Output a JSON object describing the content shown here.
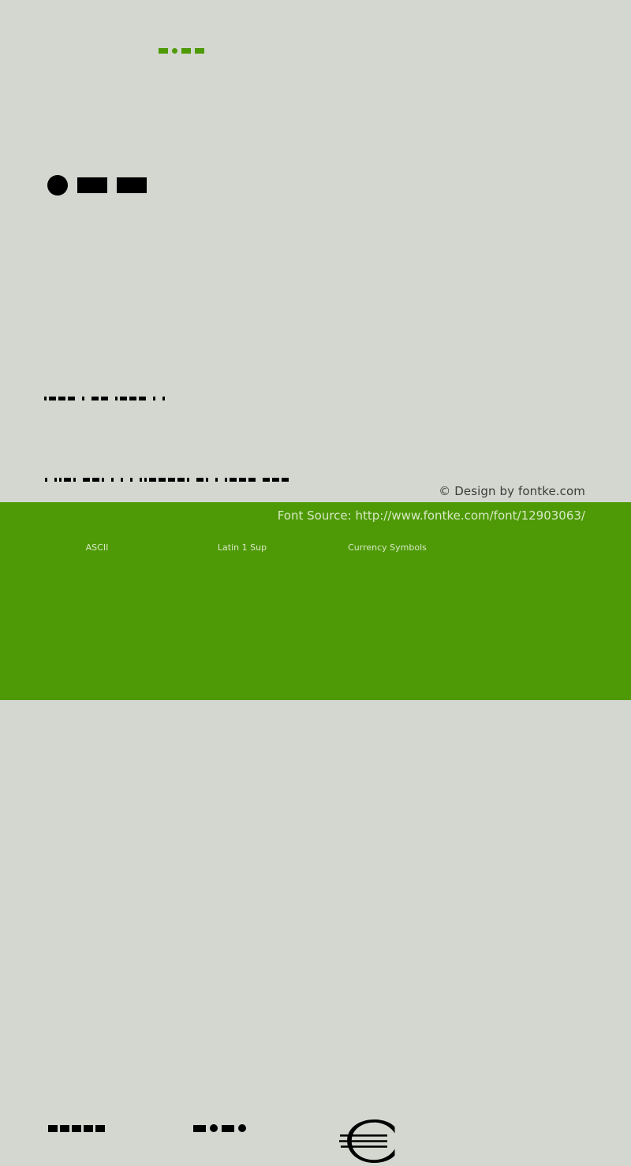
{
  "colors": {
    "background": "#d3d7cf",
    "accent_green": "#4e9a06",
    "glyph_black": "#000000",
    "footer_text": "#d8e8c4",
    "copyright_text": "#3b3b3b"
  },
  "preview": {
    "title_sample": {
      "label": "title-glyph-row",
      "marks": [
        "rect",
        "dot",
        "rect",
        "rect"
      ]
    },
    "headline_sample": {
      "label": "headline-glyph-row",
      "marks": [
        "dot",
        "rect",
        "rect"
      ]
    },
    "paragraph_sample_1": {
      "label": "paragraph-glyph-row-1",
      "marks": [
        "sq",
        "wd",
        "wd",
        "wd",
        "sp",
        "sq",
        "sp",
        "wd",
        "wd",
        "sp",
        "sq",
        "wd",
        "wd",
        "wd",
        "sp",
        "sq",
        "sp",
        "sq"
      ]
    },
    "paragraph_sample_2": {
      "label": "paragraph-glyph-row-2",
      "marks": [
        "sq",
        "sp",
        "sq",
        "sq",
        "wd",
        "sq",
        "sp",
        "wd",
        "wd",
        "sq",
        "sp",
        "sq",
        "sp",
        "sq",
        "sp",
        "sq",
        "sp",
        "sq",
        "sq",
        "wd",
        "wd",
        "wd",
        "wd",
        "sq",
        "sp",
        "wd",
        "sq",
        "sp",
        "sq",
        "sp",
        "sq",
        "wd",
        "wd",
        "wd",
        "sp",
        "wd",
        "wd",
        "wd"
      ]
    }
  },
  "copyright": {
    "text": "© Design by fontke.com"
  },
  "footer": {
    "font_source": "Font Source: http://www.fontke.com/font/12903063/",
    "blocks": [
      {
        "name": "ASCII",
        "sample_marks": [
          "rect",
          "rect",
          "rect",
          "rect",
          "rect"
        ]
      },
      {
        "name": "Latin 1 Sup",
        "sample_marks": [
          "rect",
          "dot",
          "rect",
          "dot"
        ]
      },
      {
        "name": "Currency Symbols",
        "sample_glyph": "€"
      }
    ]
  }
}
